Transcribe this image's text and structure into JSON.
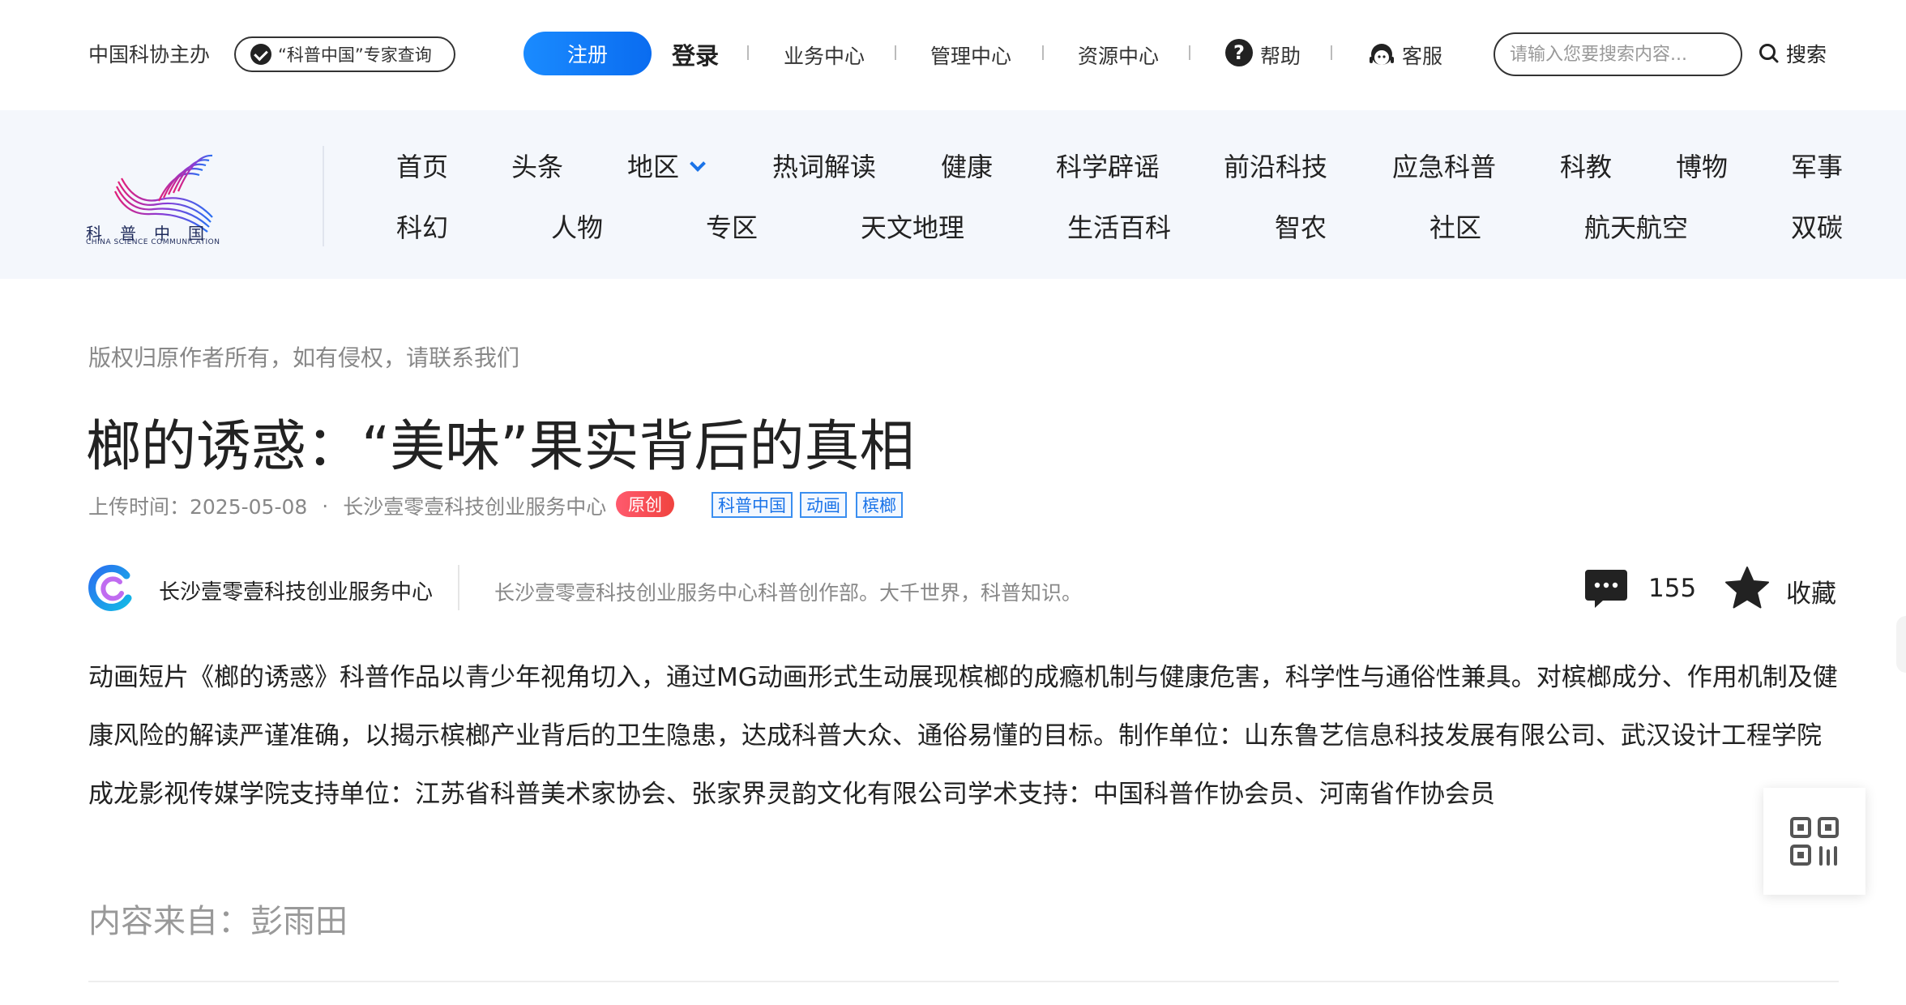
{
  "header": {
    "host": "中国科协主办",
    "expert_query": "“科普中国”专家查询",
    "register": "注册",
    "login": "登录",
    "links": [
      "业务中心",
      "管理中心",
      "资源中心"
    ],
    "help": "帮助",
    "customer_service": "客服",
    "search_placeholder": "请输入您要搜索内容...",
    "search_button": "搜索"
  },
  "logo": {
    "cn": "科普中国",
    "en": "CHINA SCIENCE COMMUNICATION"
  },
  "nav": {
    "row1": [
      "首页",
      "头条",
      "地区",
      "热词解读",
      "健康",
      "科学辟谣",
      "前沿科技",
      "应急科普",
      "科教",
      "博物",
      "军事"
    ],
    "row2": [
      "科幻",
      "人物",
      "专区",
      "天文地理",
      "生活百科",
      "智农",
      "社区",
      "航天航空",
      "双碳"
    ]
  },
  "article": {
    "copyright": "版权归原作者所有，如有侵权，请联系我们",
    "title": "榔的诱惑：“美味”果实背后的真相",
    "upload_time": "上传时间：2025-05-08",
    "dot": "·",
    "org": "长沙壹零壹科技创业服务中心",
    "original_badge": "原创",
    "tags": [
      "科普中国",
      "动画",
      "槟榔"
    ],
    "author_name": "长沙壹零壹科技创业服务中心",
    "author_desc": "长沙壹零壹科技创业服务中心科普创作部。大千世界，科普知识。",
    "comment_count": "155",
    "favorite": "收藏",
    "body": "动画短片《榔的诱惑》科普作品以青少年视角切入，通过MG动画形式生动展现槟榔的成瘾机制与健康危害，科学性与通俗性兼具。对槟榔成分、作用机制及健康风险的解读严谨准确，以揭示槟榔产业背后的卫生隐患，达成科普大众、通俗易懂的目标。制作单位：山东鲁艺信息科技发展有限公司、武汉设计工程学院成龙影视传媒学院支持单位：江苏省科普美术家协会、张家界灵韵文化有限公司学术支持：中国科普作协会员、河南省作协会员",
    "source": "内容来自：彭雨田"
  },
  "colors": {
    "accent": "#1a73e8",
    "nav_bg": "#f4f7fc",
    "original_badge": "#f0433f"
  }
}
